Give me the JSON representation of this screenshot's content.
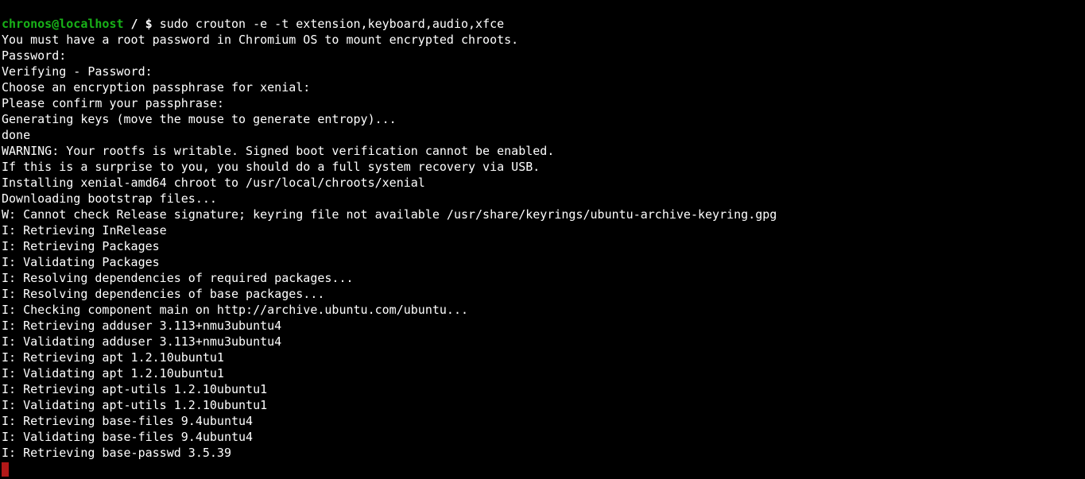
{
  "prompt": {
    "user": "chronos@localhost",
    "sep": " / ",
    "path": "",
    "dollar": "$ ",
    "command": "sudo crouton -e -t extension,keyboard,audio,xfce"
  },
  "lines": [
    "You must have a root password in Chromium OS to mount encrypted chroots.",
    "Password:",
    "Verifying - Password:",
    "Choose an encryption passphrase for xenial:",
    "Please confirm your passphrase:",
    "Generating keys (move the mouse to generate entropy)...",
    "done",
    "WARNING: Your rootfs is writable. Signed boot verification cannot be enabled.",
    "If this is a surprise to you, you should do a full system recovery via USB.",
    "Installing xenial-amd64 chroot to /usr/local/chroots/xenial",
    "Downloading bootstrap files...",
    "W: Cannot check Release signature; keyring file not available /usr/share/keyrings/ubuntu-archive-keyring.gpg",
    "I: Retrieving InRelease",
    "I: Retrieving Packages",
    "I: Validating Packages",
    "I: Resolving dependencies of required packages...",
    "I: Resolving dependencies of base packages...",
    "I: Checking component main on http://archive.ubuntu.com/ubuntu...",
    "I: Retrieving adduser 3.113+nmu3ubuntu4",
    "I: Validating adduser 3.113+nmu3ubuntu4",
    "I: Retrieving apt 1.2.10ubuntu1",
    "I: Validating apt 1.2.10ubuntu1",
    "I: Retrieving apt-utils 1.2.10ubuntu1",
    "I: Validating apt-utils 1.2.10ubuntu1",
    "I: Retrieving base-files 9.4ubuntu4",
    "I: Validating base-files 9.4ubuntu4",
    "I: Retrieving base-passwd 3.5.39"
  ]
}
